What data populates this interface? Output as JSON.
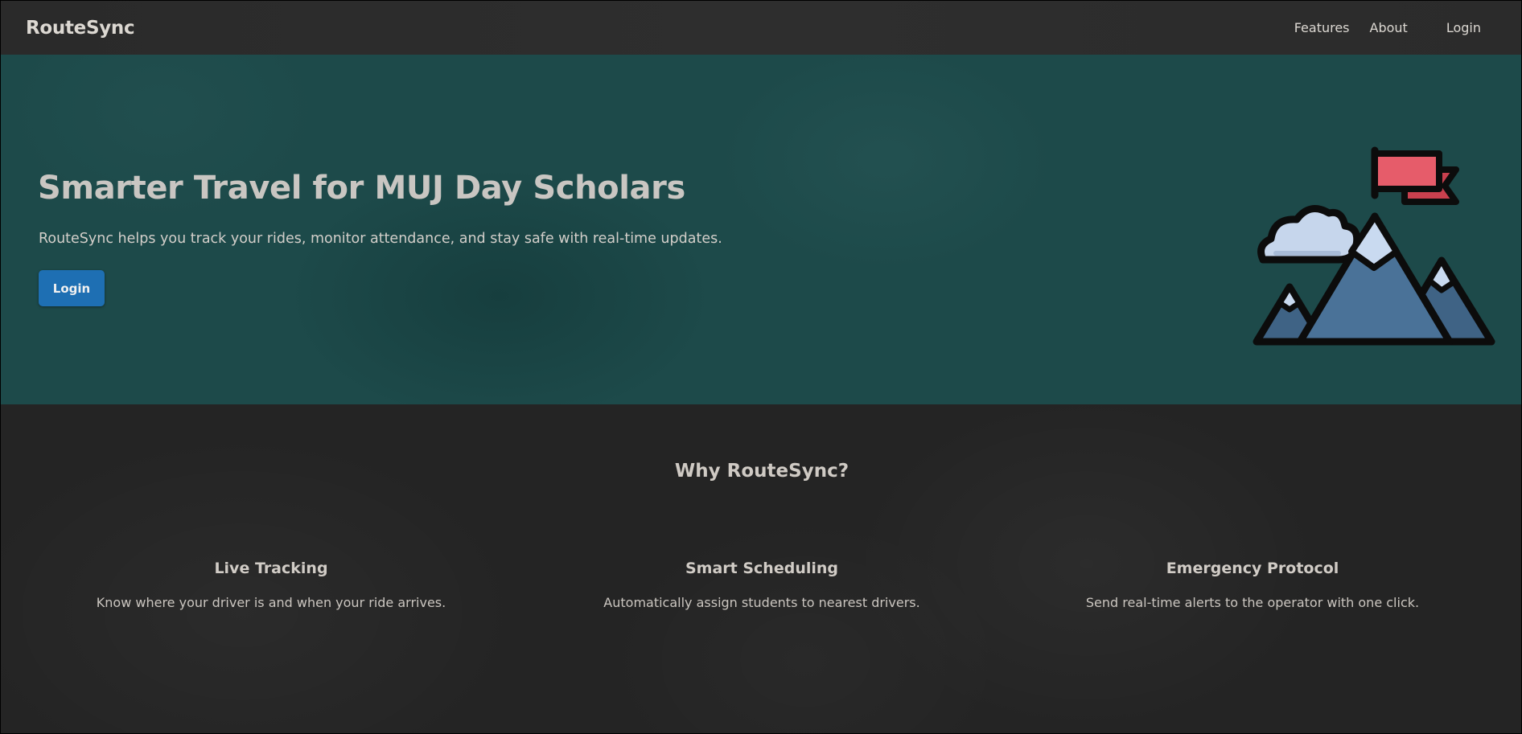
{
  "navbar": {
    "brand": "RouteSync",
    "links": [
      "Features",
      "About",
      "Login"
    ]
  },
  "hero": {
    "title": "Smarter Travel for MUJ Day Scholars",
    "subtitle": "RouteSync helps you track your rides, monitor attendance, and stay safe with real-time updates.",
    "button_label": "Login",
    "illustration_icon": "mountain-flag-icon"
  },
  "features": {
    "title": "Why RouteSync?",
    "items": [
      {
        "title": "Live Tracking",
        "description": "Know where your driver is and when your ride arrives."
      },
      {
        "title": "Smart Scheduling",
        "description": "Automatically assign students to nearest drivers."
      },
      {
        "title": "Emergency Protocol",
        "description": "Send real-time alerts to the operator with one click."
      }
    ]
  },
  "colors": {
    "hero_background": "#1d4a4a",
    "page_background": "#242424",
    "button_primary": "#1e6fb3",
    "flag_red": "#e65c6a",
    "mountain_blue": "#4a7298"
  }
}
